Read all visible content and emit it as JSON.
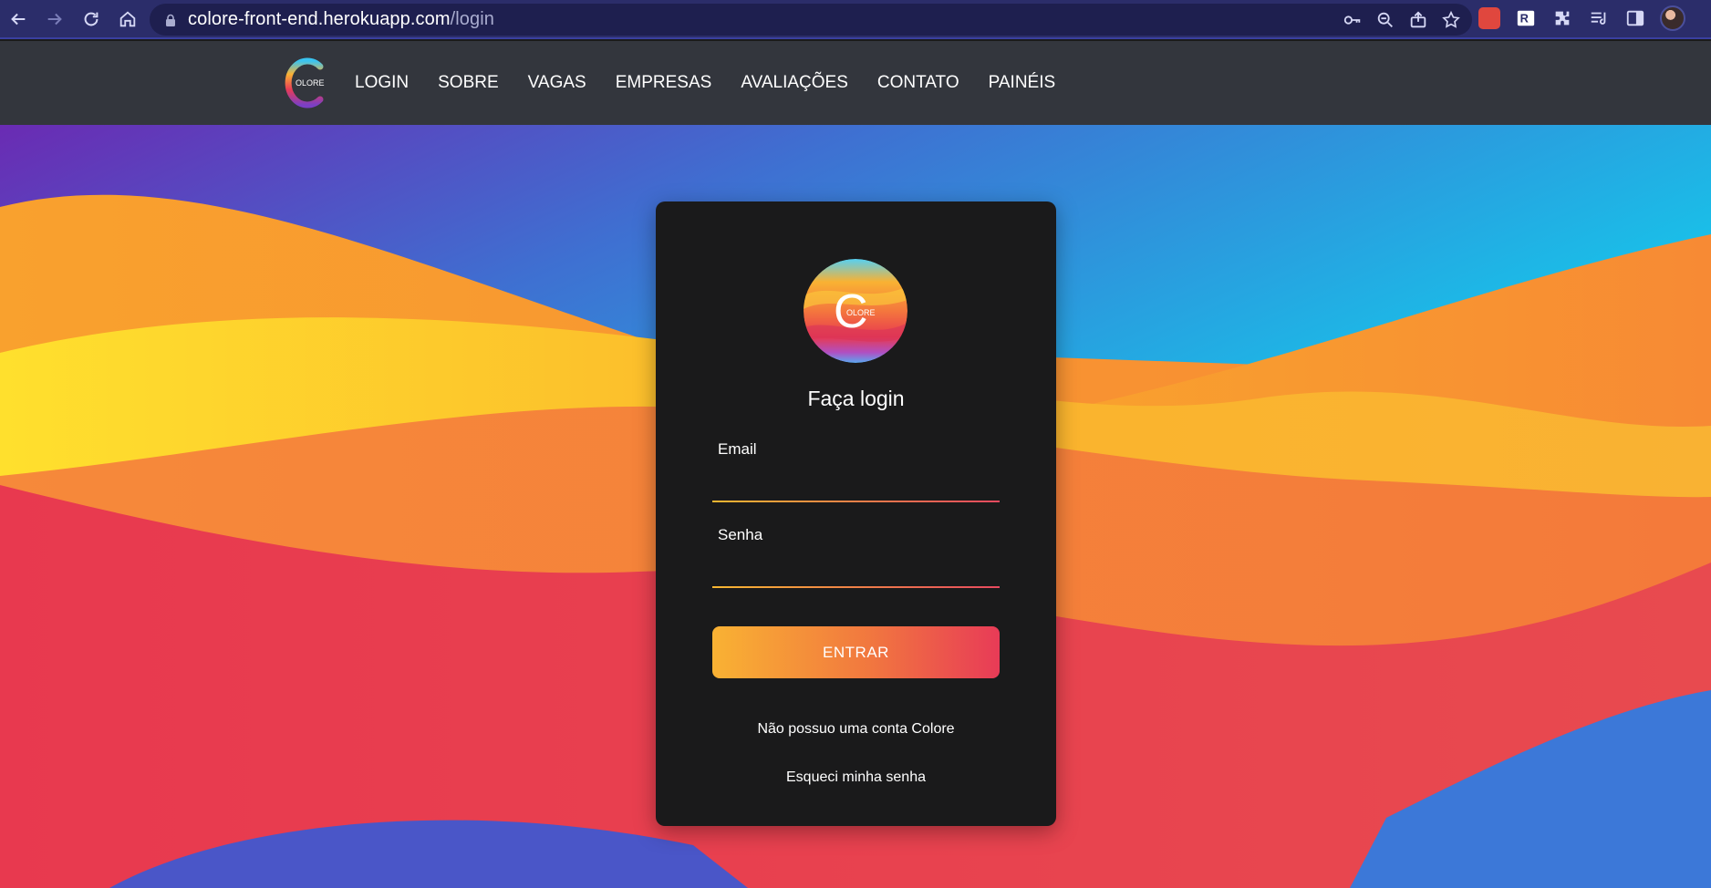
{
  "browser": {
    "url_domain": "colore-front-end.herokuapp.com",
    "url_path": "/login"
  },
  "header": {
    "logo_text": "OLORE",
    "nav": [
      "LOGIN",
      "SOBRE",
      "VAGAS",
      "EMPRESAS",
      "AVALIAÇÕES",
      "CONTATO",
      "PAINÉIS"
    ]
  },
  "login": {
    "logo_letter": "C",
    "logo_text": "OLORE",
    "title": "Faça login",
    "email_label": "Email",
    "email_value": "",
    "password_label": "Senha",
    "password_value": "",
    "submit_label": "ENTRAR",
    "signup_link": "Não possuo uma conta Colore",
    "forgot_link": "Esqueci minha senha"
  },
  "colors": {
    "browser_bar": "#2b2d6a",
    "site_header": "#33363d",
    "card_bg": "#1a1a1b",
    "accent_yellow": "#f9b233",
    "accent_red": "#e83b57"
  }
}
